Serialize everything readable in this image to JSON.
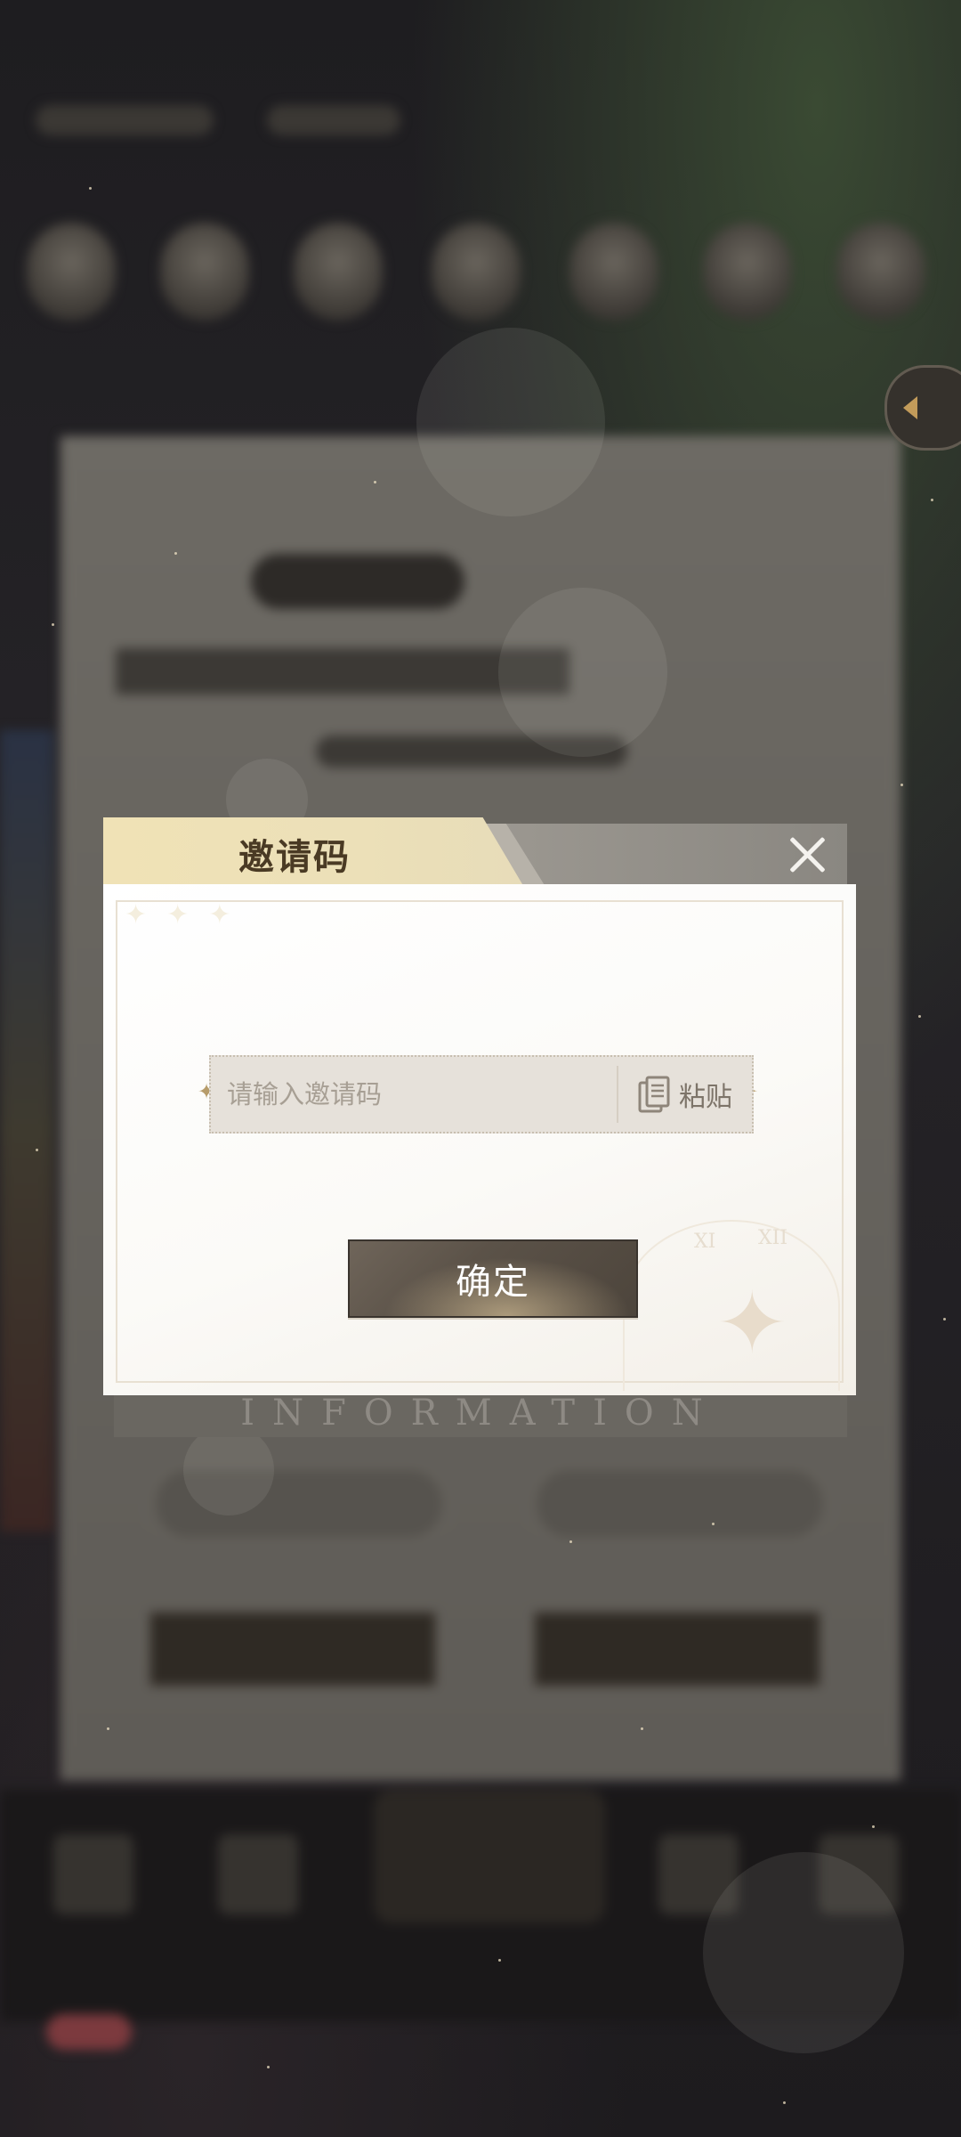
{
  "dialog": {
    "title": "邀请码",
    "input_placeholder": "请输入邀请码",
    "input_value": "",
    "paste_label": "粘贴",
    "confirm_label": "确定",
    "background_banner": "INFORMATION",
    "icons": {
      "close": "close-icon",
      "paste": "clipboard-icon"
    }
  },
  "colors": {
    "tab_gold": "#f0e2b6",
    "title_brown": "#4a3a24",
    "button_dark": "#5b5248",
    "overlay": "#17161a"
  }
}
